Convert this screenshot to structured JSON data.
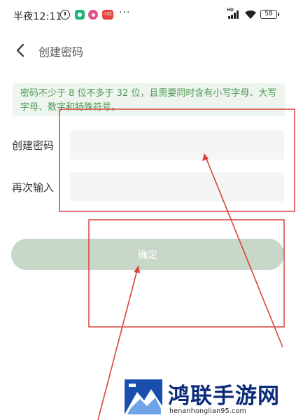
{
  "status_bar": {
    "time": "半夜12:11",
    "app_badge_label": "小红书",
    "more": "···",
    "network_label": "HD",
    "battery": "58"
  },
  "header": {
    "title": "创建密码",
    "back_icon": "chevron-left-icon"
  },
  "notice": {
    "text": "密码不少于 8 位不多于 32 位，且需要同时含有小写字母、大写字母、数字和特殊符号。"
  },
  "form": {
    "create_password_label": "创建密码",
    "create_password_value": "",
    "confirm_password_label": "再次输入",
    "confirm_password_value": ""
  },
  "actions": {
    "confirm_label": "确定"
  },
  "watermark": {
    "name": "鸿联手游网",
    "url": "henanhonglian95.com"
  },
  "colors": {
    "notice_bg": "#eef5ee",
    "notice_text": "#4d9a55",
    "button_bg": "#c7d7c8",
    "input_bg": "#f4f5f4",
    "annotation_red": "#d9433b",
    "watermark_blue": "#0a2a7a"
  }
}
